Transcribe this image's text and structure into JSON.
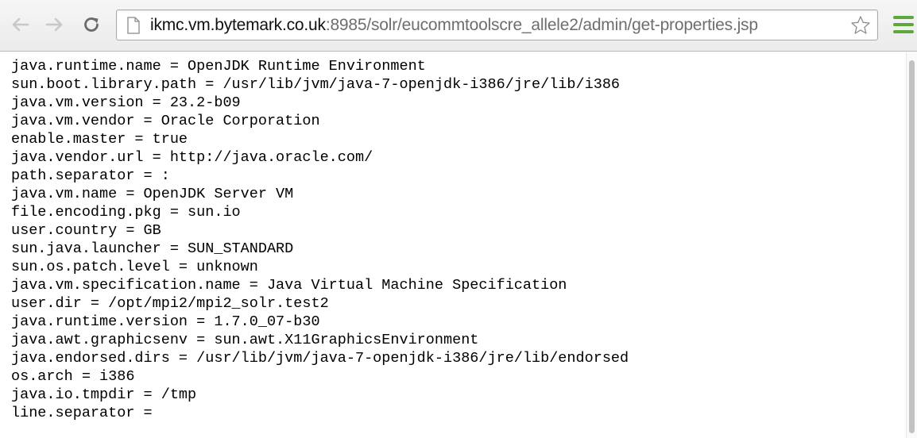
{
  "browser": {
    "back_icon": "back-arrow-icon",
    "forward_icon": "forward-arrow-icon",
    "reload_icon": "reload-icon",
    "page_icon": "page-icon",
    "bookmark_icon": "star-icon",
    "menu_icon": "hamburger-menu-icon",
    "url_host": "ikmc.vm.bytemark.co.uk",
    "url_rest": ":8985/solr/eucommtoolscre_allele2/admin/get-properties.jsp",
    "colors": {
      "menu_accent": "#5ca83c",
      "url_host": "#111111",
      "url_rest": "#6e6e6e"
    }
  },
  "properties": [
    "java.runtime.name = OpenJDK Runtime Environment",
    "sun.boot.library.path = /usr/lib/jvm/java-7-openjdk-i386/jre/lib/i386",
    "java.vm.version = 23.2-b09",
    "java.vm.vendor = Oracle Corporation",
    "enable.master = true",
    "java.vendor.url = http://java.oracle.com/",
    "path.separator = :",
    "java.vm.name = OpenJDK Server VM",
    "file.encoding.pkg = sun.io",
    "user.country = GB",
    "sun.java.launcher = SUN_STANDARD",
    "sun.os.patch.level = unknown",
    "java.vm.specification.name = Java Virtual Machine Specification",
    "user.dir = /opt/mpi2/mpi2_solr.test2",
    "java.runtime.version = 1.7.0_07-b30",
    "java.awt.graphicsenv = sun.awt.X11GraphicsEnvironment",
    "java.endorsed.dirs = /usr/lib/jvm/java-7-openjdk-i386/jre/lib/endorsed",
    "os.arch = i386",
    "java.io.tmpdir = /tmp",
    "line.separator ="
  ]
}
